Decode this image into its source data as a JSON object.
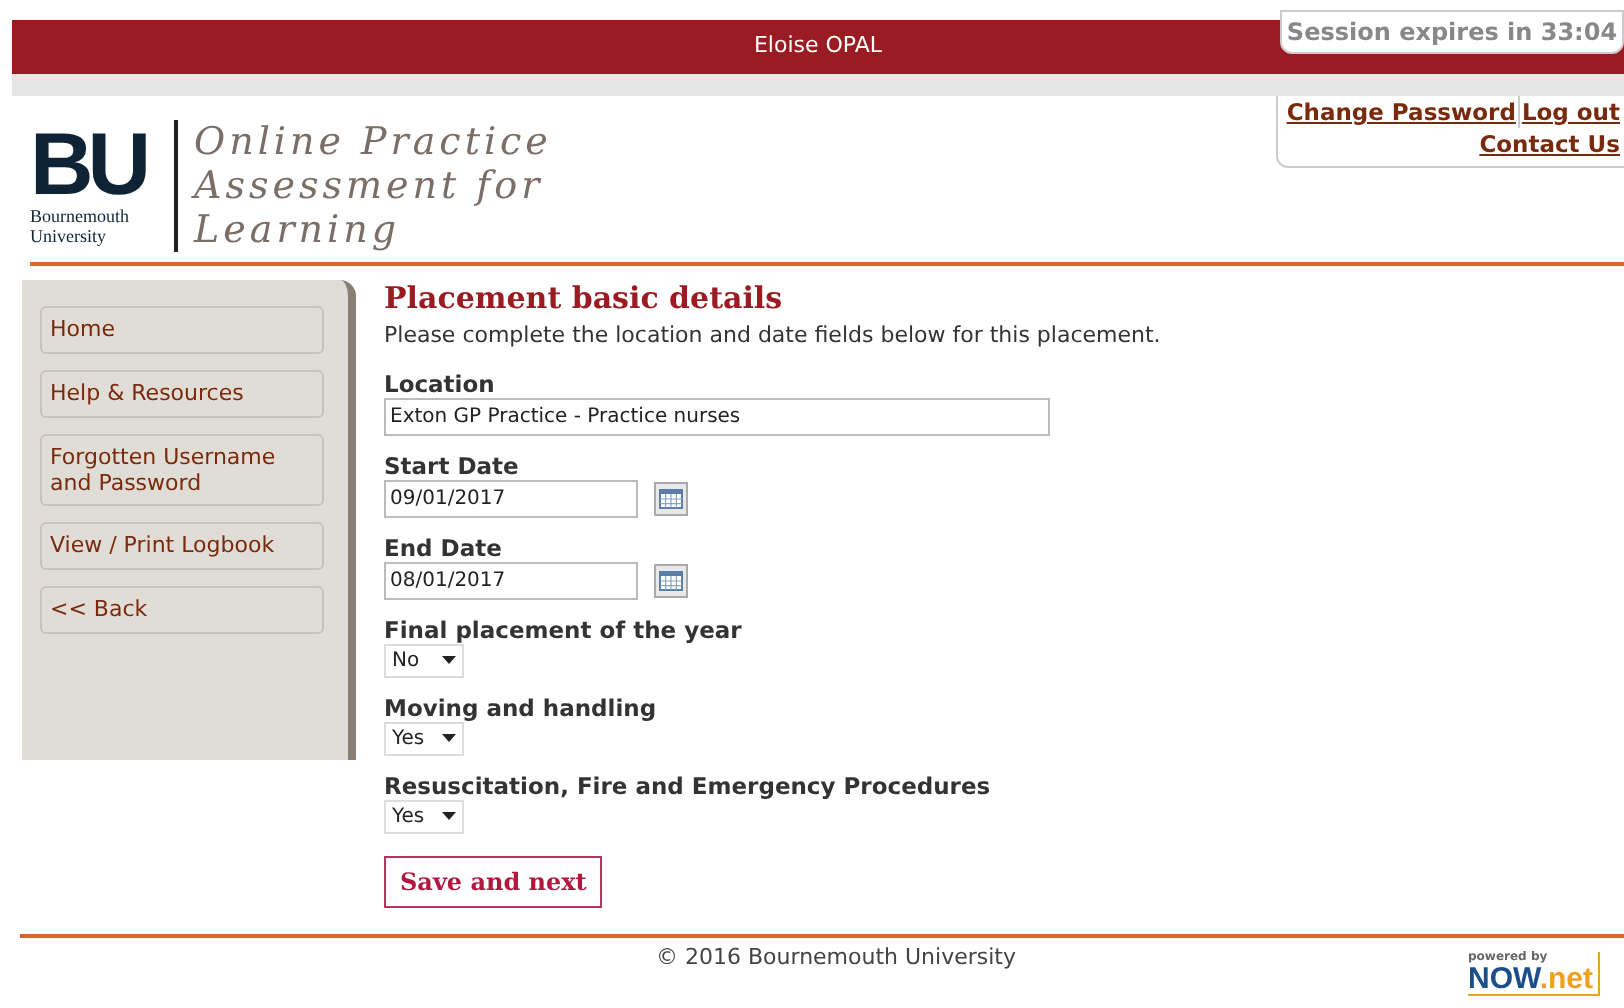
{
  "top_bar": {
    "user": "Eloise OPAL",
    "session": "Session expires in 33:04"
  },
  "header": {
    "logo_mark": "BU",
    "logo_name": "Bournemouth University",
    "title_lines": [
      "Online Practice",
      "Assessment for",
      "Learning"
    ],
    "link_rows": [
      [
        "Change Password",
        "Log out"
      ],
      [
        "Contact Us"
      ]
    ]
  },
  "sidebar": {
    "items": [
      {
        "label": "Home"
      },
      {
        "label": "Help & Resources"
      },
      {
        "label": "Forgotten Username and Password"
      },
      {
        "label": "View / Print Logbook"
      },
      {
        "label": "<< Back"
      }
    ]
  },
  "form": {
    "heading": "Placement basic details",
    "intro": "Please complete the location and date fields below for this placement.",
    "fields": [
      {
        "kind": "text",
        "label": "Location",
        "value": "Exton GP Practice - Practice nurses"
      },
      {
        "kind": "date",
        "label": "Start Date",
        "value": "09/01/2017"
      },
      {
        "kind": "date",
        "label": "End Date",
        "value": "08/01/2017"
      },
      {
        "kind": "select",
        "label": "Final placement of the year",
        "value": "No"
      },
      {
        "kind": "select",
        "label": "Moving and handling",
        "value": "Yes"
      },
      {
        "kind": "select",
        "label": "Resuscitation, Fire and Emergency Procedures",
        "value": "Yes"
      }
    ],
    "submit": "Save and next"
  },
  "footer": {
    "copyright": "© 2016 Bournemouth University",
    "powered_by": "powered by",
    "brand_main": "NOW",
    "brand_suffix": ".net"
  }
}
